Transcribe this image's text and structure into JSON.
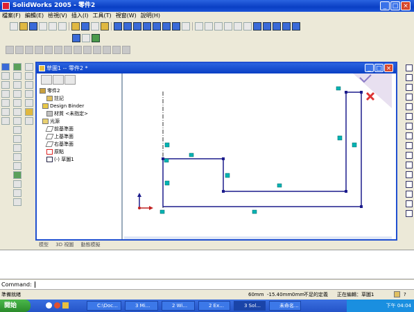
{
  "app": {
    "title": "SolidWorks 2005 - 零件2"
  },
  "menu": [
    "檔案(F)",
    "編輯(E)",
    "檢視(V)",
    "插入(I)",
    "工具(T)",
    "視窗(W)",
    "說明(H)"
  ],
  "window_controls": {
    "minimize": "_",
    "restore": "□",
    "close": "×"
  },
  "doc": {
    "title": "草圖1 -- 零件2 *"
  },
  "tree": {
    "items": [
      {
        "label": "零件2",
        "icon": "part-icon"
      },
      {
        "label": "註記",
        "icon": "annotation-icon"
      },
      {
        "label": "Design Binder",
        "icon": "binder-icon"
      },
      {
        "label": "材質 <未指定>",
        "icon": "material-icon"
      },
      {
        "label": "光源",
        "icon": "light-icon"
      },
      {
        "label": "前基準面",
        "icon": "plane-icon"
      },
      {
        "label": "上基準面",
        "icon": "plane-icon"
      },
      {
        "label": "右基準面",
        "icon": "plane-icon"
      },
      {
        "label": "原點",
        "icon": "origin-icon"
      },
      {
        "label": "(-) 草圖1",
        "icon": "sketch-icon"
      }
    ]
  },
  "bottom_tabs": [
    "模型",
    "3D 視圖",
    "動態模擬"
  ],
  "command": {
    "label": "Command:",
    "value": ""
  },
  "status": {
    "left": "準備就緒",
    "x": "60mm",
    "y": "-15.40mm",
    "z": "0mm",
    "sketch_state": "不足的定義",
    "editing": "正在編輯：草圖1",
    "help": "?"
  },
  "taskbar": {
    "start": "開始",
    "items": [
      "C:\\Doc...",
      "3 Mi...",
      "2 Wi...",
      "2 Ex...",
      "3 Sol...",
      "未命名..."
    ],
    "clock": "下午 04:04"
  },
  "colors": {
    "accent": "#1f4fd0",
    "sketch_line": "#1c1c8c",
    "relation": "#00b4b4"
  }
}
